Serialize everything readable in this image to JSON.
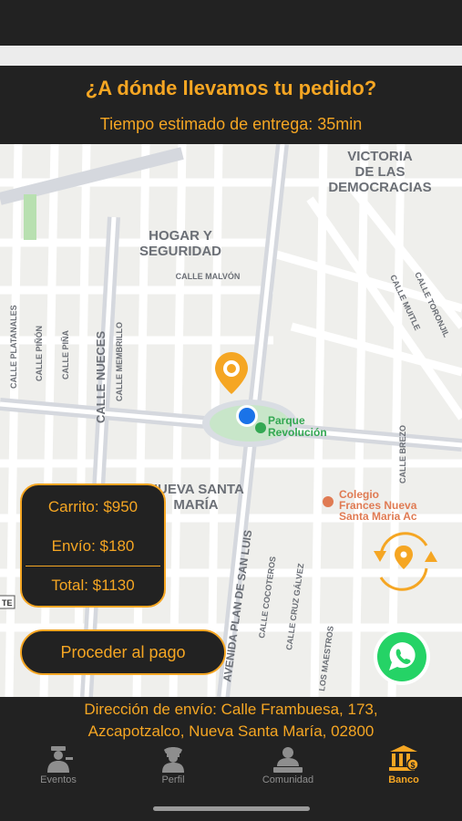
{
  "header": {
    "title": "¿A dónde llevamos tu pedido?",
    "eta": "Tiempo estimado de entrega: 35min"
  },
  "map": {
    "labels": {
      "victoria1": "VICTORIA",
      "victoria2": "DE LAS",
      "victoria3": "DEMOCRACIAS",
      "hogar1": "HOGAR Y",
      "hogar2": "SEGURIDAD",
      "malvon": "CALLE MALVÓN",
      "toronjil": "CALLE TORONJIL",
      "muitle": "CALLE MUITLE",
      "platanales": "CALLE PLATANALES",
      "pinon": "CALLE PIÑÓN",
      "pina": "CALLE PIÑA",
      "nueces": "CALLE NUECES",
      "membrillo": "CALLE MEMBRILLO",
      "parque1": "Parque",
      "parque2": "Revolución",
      "nsm1": "NUEVA SANTA",
      "nsm2": "MARÍA",
      "colegio1": "Colegio",
      "colegio2": "Frances Nueva",
      "colegio3": "Santa Maria Ac",
      "brezo": "CALLE BREZO",
      "plansanluis": "AVENIDA PLAN DE SAN LUIS",
      "cocoteros": "CALLE COCOTEROS",
      "cruzgalvez": "CALLE CRUZ GÁLVEZ",
      "maestros": "LOS MAESTROS",
      "te": "TE"
    }
  },
  "cart": {
    "carrito": "Carrito: $950",
    "envio": "Envío: $180",
    "total": "Total: $1130"
  },
  "pay_button": "Proceder al pago",
  "address": {
    "line1": "Dirección de envío:  Calle Frambuesa, 173,",
    "line2": "Azcapotzalco, Nueva Santa María, 02800"
  },
  "tabs": [
    {
      "label": "Eventos",
      "icon": "police-officer-icon",
      "active": false
    },
    {
      "label": "Perfil",
      "icon": "agent-profile-icon",
      "active": false
    },
    {
      "label": "Comunidad",
      "icon": "community-icon",
      "active": false
    },
    {
      "label": "Banco",
      "icon": "bank-icon",
      "active": true
    }
  ],
  "colors": {
    "accent": "#f5a623",
    "dark": "#222222",
    "location_dot": "#1a73e8",
    "park": "#c8e6c9",
    "whatsapp": "#25d366"
  }
}
